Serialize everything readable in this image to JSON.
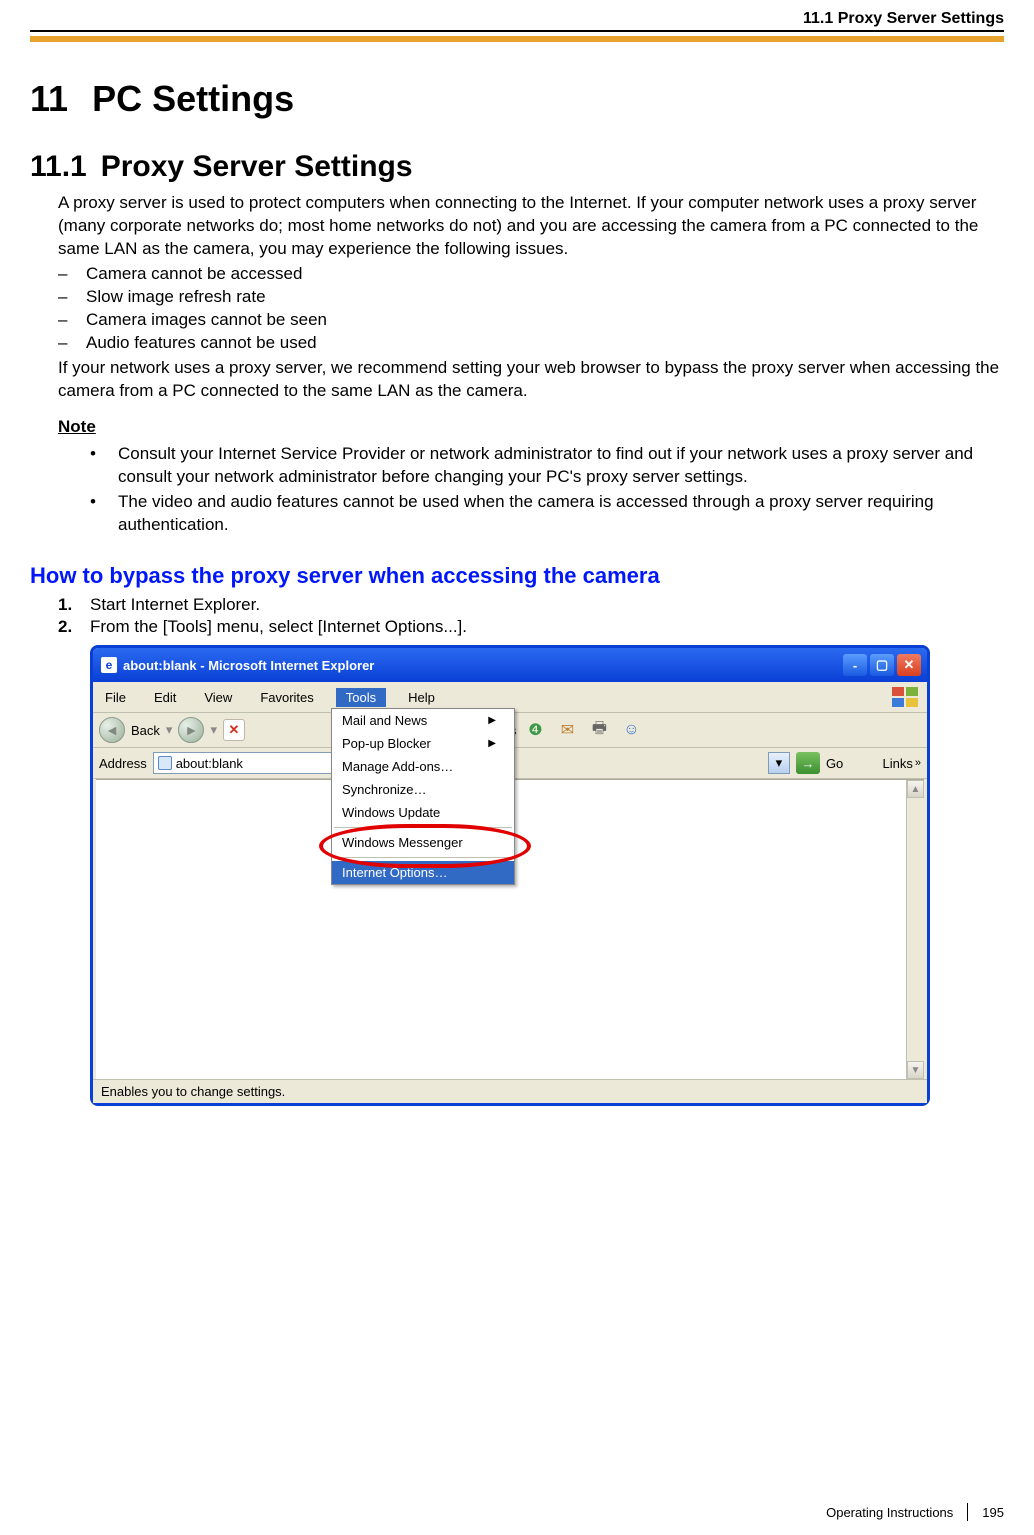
{
  "header": {
    "running": "11.1 Proxy Server Settings"
  },
  "chapter": {
    "num": "11",
    "title": "PC Settings"
  },
  "section": {
    "num": "11.1",
    "title": "Proxy Server Settings"
  },
  "intro": "A proxy server is used to protect computers when connecting to the Internet. If your computer network uses a proxy server (many corporate networks do; most home networks do not) and you are accessing the camera from a PC connected to the same LAN as the camera, you may experience the following issues.",
  "issues": [
    "Camera cannot be accessed",
    "Slow image refresh rate",
    "Camera images cannot be seen",
    "Audio features cannot be used"
  ],
  "after_issues": "If your network uses a proxy server, we recommend setting your web browser to bypass the proxy server when accessing the camera from a PC connected to the same LAN as the camera.",
  "note_label": "Note",
  "notes": [
    "Consult your Internet Service Provider or network administrator to find out if your network uses a proxy server and consult your network administrator before changing your PC's proxy server settings.",
    "The video and audio features cannot be used when the camera is accessed through a proxy server requiring authentication."
  ],
  "howto_heading": "How to bypass the proxy server when accessing the camera",
  "steps": [
    "Start Internet Explorer.",
    "From the [Tools] menu, select [Internet Options...]."
  ],
  "ie": {
    "title": "about:blank - Microsoft Internet Explorer",
    "menubar": [
      "File",
      "Edit",
      "View",
      "Favorites",
      "Tools",
      "Help"
    ],
    "tools_menu": [
      "Mail and News",
      "Pop-up Blocker",
      "Manage Add-ons…",
      "Synchronize…",
      "Windows Update",
      "__SEP__",
      "Windows Messenger",
      "__SEP__",
      "Internet Options…"
    ],
    "back_label": "Back",
    "favorites_label": "Favorites",
    "address_label": "Address",
    "address_value": "about:blank",
    "go_label": "Go",
    "links_label": "Links",
    "status": "Enables you to change settings."
  },
  "footer": {
    "doc": "Operating Instructions",
    "page": "195"
  }
}
